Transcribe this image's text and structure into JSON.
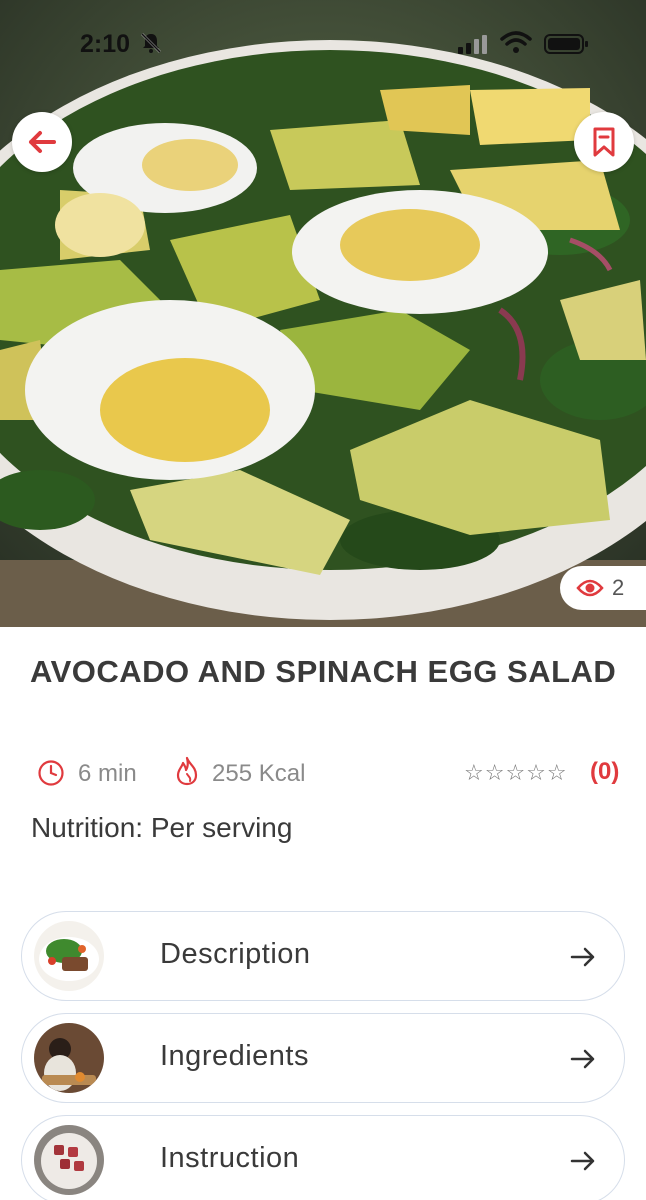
{
  "status_bar": {
    "time": "2:10"
  },
  "hero": {
    "views": "2"
  },
  "recipe": {
    "title": "AVOCADO AND SPINACH EGG SALAD",
    "time": "6 min",
    "calories": "255 Kcal",
    "rating_stars": "☆☆☆☆☆",
    "rating_count": "(0)",
    "nutrition": "Nutrition: Per serving"
  },
  "sections": [
    {
      "label": "Description"
    },
    {
      "label": "Ingredients"
    },
    {
      "label": "Instruction"
    }
  ],
  "colors": {
    "accent": "#e03a3e",
    "text": "#3a3a3a",
    "muted": "#8a8a8a",
    "card_border": "#d6deea"
  }
}
